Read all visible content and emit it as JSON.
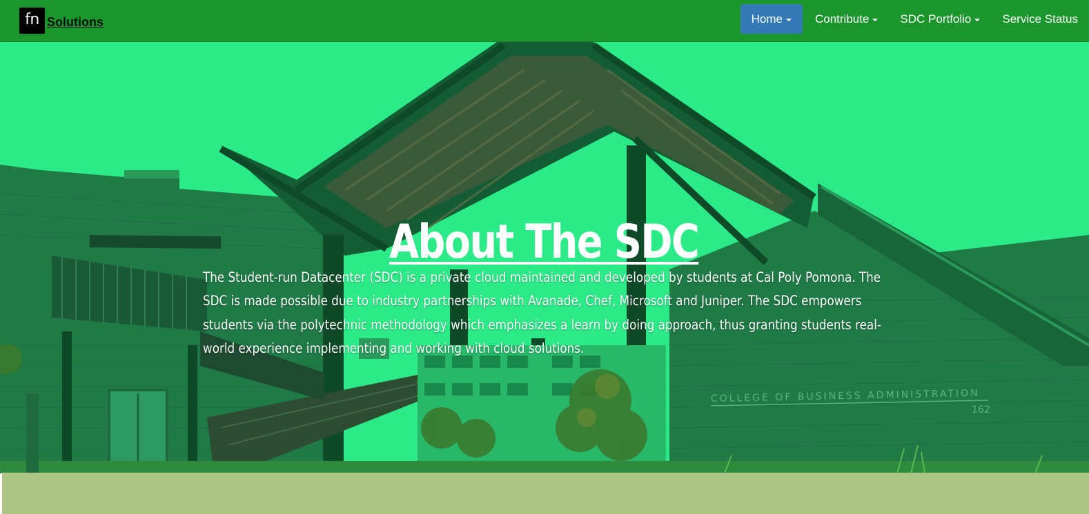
{
  "brand": {
    "logo_text": "fn",
    "name": "Solutions"
  },
  "nav": {
    "items": [
      {
        "label": "Home",
        "has_dropdown": true,
        "active": true
      },
      {
        "label": "Contribute",
        "has_dropdown": true,
        "active": false
      },
      {
        "label": "SDC Portfolio",
        "has_dropdown": true,
        "active": false
      },
      {
        "label": "Service Status",
        "has_dropdown": false,
        "active": false
      }
    ]
  },
  "hero": {
    "title": "About The SDC",
    "description": "The Student-run Datacenter (SDC) is a private cloud maintained and developed by students at Cal Poly Pomona. The SDC is made possible due to industry partnerships with Avanade, Chef, Microsoft and Juniper. The SDC empowers students via the polytechnic methodology which emphasizes a learn by doing approach, thus granting students real-world experience implementing and working with cloud solutions.",
    "building_sign": "COLLEGE OF BUSINESS ADMINISTRATION",
    "building_number": "162"
  },
  "colors": {
    "navbar": "#1a962d",
    "active_nav": "#337ab7",
    "hero_tint": "#2bea87",
    "bottom_strip": "#aec588"
  },
  "icons": {
    "dropdown": "caret-down-icon"
  }
}
